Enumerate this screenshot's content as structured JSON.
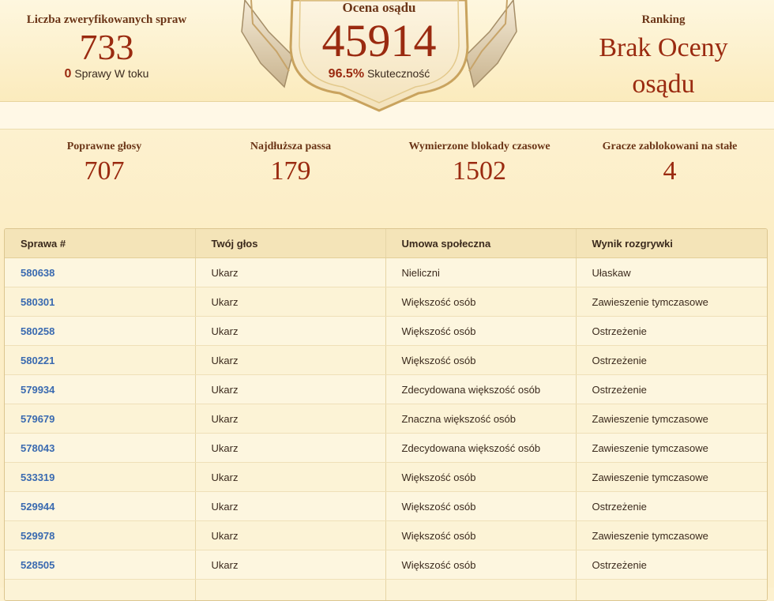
{
  "summary": {
    "verified_label": "Liczba zweryfikowanych spraw",
    "verified_value": "733",
    "in_progress_value": "0",
    "in_progress_label": "Sprawy W toku",
    "rating_label": "Ocena osądu",
    "rating_value": "45914",
    "accuracy_value": "96.5%",
    "accuracy_label": "Skuteczność",
    "ranking_label": "Ranking",
    "ranking_value": "Brak Oceny osądu"
  },
  "stats": [
    {
      "label": "Poprawne głosy",
      "value": "707"
    },
    {
      "label": "Najdłuższa passa",
      "value": "179"
    },
    {
      "label": "Wymierzone blokady czasowe",
      "value": "1502"
    },
    {
      "label": "Gracze zablokowani na stałe",
      "value": "4"
    }
  ],
  "table": {
    "headers": [
      "Sprawa #",
      "Twój głos",
      "Umowa społeczna",
      "Wynik rozgrywki"
    ],
    "rows": [
      [
        "580638",
        "Ukarz",
        "Nieliczni",
        "Ułaskaw"
      ],
      [
        "580301",
        "Ukarz",
        "Większość osób",
        "Zawieszenie tymczasowe"
      ],
      [
        "580258",
        "Ukarz",
        "Większość osób",
        "Ostrzeżenie"
      ],
      [
        "580221",
        "Ukarz",
        "Większość osób",
        "Ostrzeżenie"
      ],
      [
        "579934",
        "Ukarz",
        "Zdecydowana większość osób",
        "Ostrzeżenie"
      ],
      [
        "579679",
        "Ukarz",
        "Znaczna większość osób",
        "Zawieszenie tymczasowe"
      ],
      [
        "578043",
        "Ukarz",
        "Zdecydowana większość osób",
        "Zawieszenie tymczasowe"
      ],
      [
        "533319",
        "Ukarz",
        "Większość osób",
        "Zawieszenie tymczasowe"
      ],
      [
        "529944",
        "Ukarz",
        "Większość osób",
        "Ostrzeżenie"
      ],
      [
        "529978",
        "Ukarz",
        "Większość osób",
        "Zawieszenie tymczasowe"
      ],
      [
        "528505",
        "Ukarz",
        "Większość osób",
        "Ostrzeżenie"
      ],
      [
        "",
        "",
        "",
        ""
      ]
    ]
  }
}
